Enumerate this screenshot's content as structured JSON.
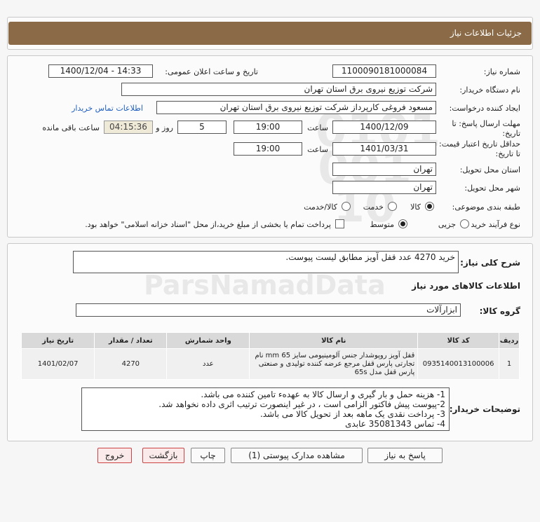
{
  "header": {
    "title": "جزئیات اطلاعات نیاز"
  },
  "form": {
    "need_number_label": "شماره نیاز:",
    "need_number": "1100090181000084",
    "announce_label": "تاریخ و ساعت اعلان عمومی:",
    "announce_value": "1400/12/04 - 14:33",
    "buyer_org_label": "نام دستگاه خریدار:",
    "buyer_org": "شرکت توزیع نیروی برق استان تهران",
    "requester_label": "ایجاد کننده درخواست:",
    "requester": "مسعود فروغی کارپرداز شرکت توزیع نیروی برق استان تهران",
    "contact_link": "اطلاعات تماس خریدار",
    "deadline_label": "مهلت ارسال پاسخ: تا تاریخ:",
    "deadline_date": "1400/12/09",
    "time_label": "ساعت",
    "deadline_time": "19:00",
    "days_value": "5",
    "days_label": "روز و",
    "remaining_time": "04:15:36",
    "remaining_label": "ساعت باقی مانده",
    "validity_label": "حداقل تاریخ اعتبار قیمت: تا تاریخ:",
    "validity_date": "1401/03/31",
    "validity_time": "19:00",
    "province_label": "استان محل تحویل:",
    "province": "تهران",
    "city_label": "شهر محل تحویل:",
    "city": "تهران",
    "category_label": "طبقه بندی موضوعی:",
    "category_options": [
      "کالا",
      "خدمت",
      "کالا/خدمت"
    ],
    "process_label": "نوع فرآیند خرید :",
    "process_options": [
      "جزیی",
      "متوسط"
    ],
    "payment_note": "پرداخت تمام یا بخشی از مبلغ خرید،از محل \"اسناد خزانه اسلامی\" خواهد بود."
  },
  "summary": {
    "label": "شرح کلی نیاز:",
    "text": "خرید 4270 عدد قفل آویز مطابق لیست پیوست."
  },
  "goods": {
    "section_title": "اطلاعات کالاهای مورد نیاز",
    "group_label": "گروه کالا:",
    "group_value": "ابزارآلات",
    "columns": [
      "ردیف",
      "کد کالا",
      "نام کالا",
      "واحد شمارش",
      "تعداد / مقدار",
      "تاریخ نیاز"
    ],
    "rows": [
      {
        "row": "1",
        "code": "0935140013100006",
        "name": "قفل آویز روپوشدار جنس آلومینیومی سایز 65 mm نام تجارتی پارس قفل مرجع عرضه کننده تولیدی و صنعتی پارس قفل مدل 65s",
        "unit": "عدد",
        "qty": "4270",
        "date": "1401/02/07"
      }
    ]
  },
  "notes": {
    "label": "توضیحات خریدار:",
    "lines": [
      "1- هزینه حمل و بار گیری و ارسال کالا به عهدهء تامین کننده می باشد.",
      "2-پیوست پیش فاکتور الزامی است ، در غیر اینصورت ترتیب اثری داده نخواهد شد.",
      "3- پرداخت نقدی یک ماهه بعد از تحویل کالا می باشد.",
      "4- تماس 35081343 عابدی"
    ]
  },
  "buttons": {
    "reply": "پاسخ به نیاز",
    "attachments": "مشاهده مدارک پیوستی (1)",
    "print": "چاپ",
    "back": "بازگشت",
    "exit": "خروج"
  },
  "watermark": {
    "brand": "ParsNamadData"
  }
}
